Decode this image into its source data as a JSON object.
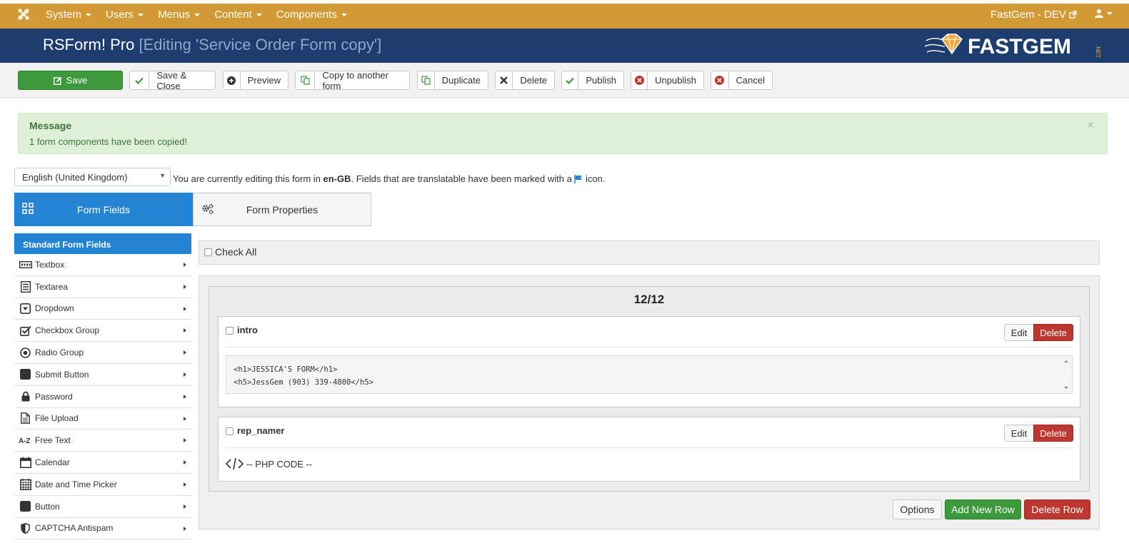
{
  "topnav": {
    "menu": [
      "System",
      "Users",
      "Menus",
      "Content",
      "Components"
    ],
    "site_name": "FastGem - DEV",
    "logo_icon": "joomla-icon",
    "user_icon": "user-icon"
  },
  "header": {
    "app_name": "RSForm! Pro",
    "subtitle": "[Editing 'Service Order Form copy']",
    "brand": "FASTGEM",
    "brand_suffix": ".NET"
  },
  "toolbar": {
    "save": "Save",
    "save_close": "Save & Close",
    "preview": "Preview",
    "copy": "Copy to another form",
    "duplicate": "Duplicate",
    "delete": "Delete",
    "publish": "Publish",
    "unpublish": "Unpublish",
    "cancel": "Cancel"
  },
  "message": {
    "title": "Message",
    "text": "1 form components have been copied!",
    "close": "×"
  },
  "language": {
    "selected": "English (United Kingdom)",
    "info_pre": "You are currently editing this form in ",
    "info_lang": "en-GB",
    "info_post": ". Fields that are translatable have been marked with a ",
    "info_end": " icon."
  },
  "tabs": {
    "form_fields": "Form Fields",
    "form_properties": "Form Properties"
  },
  "sidebar": {
    "heading": "Standard Form Fields",
    "items": [
      {
        "label": "Textbox",
        "icon": "textbox-icon"
      },
      {
        "label": "Textarea",
        "icon": "textarea-icon"
      },
      {
        "label": "Dropdown",
        "icon": "dropdown-icon"
      },
      {
        "label": "Checkbox Group",
        "icon": "checkbox-icon"
      },
      {
        "label": "Radio Group",
        "icon": "radio-icon"
      },
      {
        "label": "Submit Button",
        "icon": "submit-icon"
      },
      {
        "label": "Password",
        "icon": "lock-icon"
      },
      {
        "label": "File Upload",
        "icon": "file-icon"
      },
      {
        "label": "Free Text",
        "icon": "az-icon"
      },
      {
        "label": "Calendar",
        "icon": "calendar-icon"
      },
      {
        "label": "Date and Time Picker",
        "icon": "datetime-icon"
      },
      {
        "label": "Button",
        "icon": "button-icon"
      },
      {
        "label": "CAPTCHA Antispam",
        "icon": "shield-icon"
      }
    ]
  },
  "main": {
    "check_all": "Check All",
    "pager": "12/12",
    "fields": [
      {
        "name": "intro",
        "edit": "Edit",
        "delete": "Delete",
        "code_lines": [
          "<h1>JESSICA'S FORM</h1>",
          "<h5>JessGem (903) 339-4800</h5>"
        ]
      },
      {
        "name": "rep_namer",
        "edit": "Edit",
        "delete": "Delete",
        "preview": "-- PHP CODE --"
      }
    ],
    "options": "Options",
    "add_row": "Add New Row",
    "delete_row": "Delete Row"
  },
  "colors": {
    "topbar": "#d29a35",
    "header": "#1c3d6e",
    "primary": "#2384d3",
    "success": "#3c9a3c",
    "danger": "#bd362f"
  }
}
